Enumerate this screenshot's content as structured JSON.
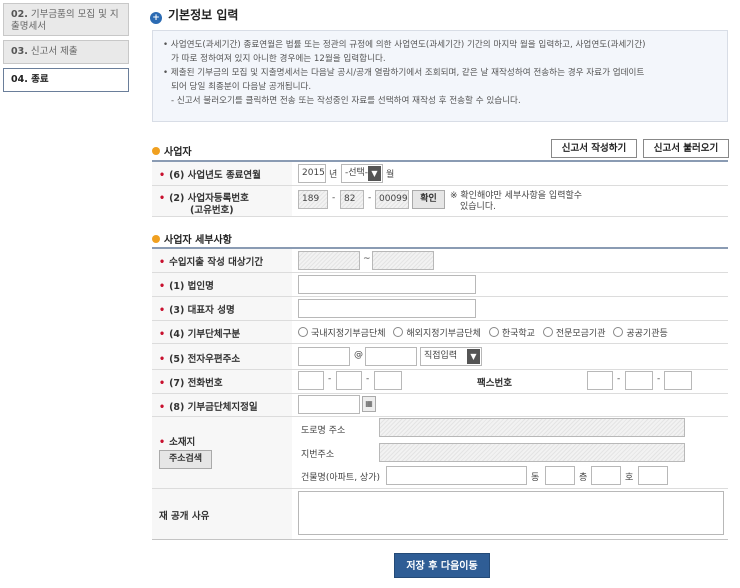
{
  "nav": {
    "items": [
      {
        "num": "02.",
        "label": "기부금품의 모집 및 지출명세서"
      },
      {
        "num": "03.",
        "label": "신고서 제출"
      },
      {
        "num": "04.",
        "label": "종료"
      }
    ]
  },
  "header": {
    "title": "기본정보 입력"
  },
  "info": {
    "lines": [
      "• 사업연도(과세기간) 종료연월은 법률 또는 정관의 규정에 의한 사업연도(과세기간) 기간의 마지막 월을 입력하고, 사업연도(과세기간)",
      "가 따로 정하여져 있지 아니한 경우에는 12월을 입력합니다.",
      "• 제출된 기부금의 모집 및 지출명세서는 다음날 공시/공개 열람하기에서 조회되며, 같은 날 재작성하여 전송하는 경우 자료가 업데이트",
      "되어 당일 최종분이 다음날 공개됩니다.",
      "- 신고서 불러오기를 클릭하면 전송 또는 작성중인 자료를 선택하여 재작성 후 전송할 수 있습니다."
    ]
  },
  "business": {
    "section_title": "사업자",
    "write_button": "신고서 작성하기",
    "load_button": "신고서 불러오기",
    "period_label": "(6) 사업년도 종료연월",
    "year_value": "2015",
    "year_unit": "년",
    "month_select": "-선택-",
    "month_unit": "월",
    "regno_label": "(2) 사업자등록번호",
    "regno_sublabel": "(고유번호)",
    "regno_1": "189",
    "regno_2": "82",
    "regno_3": "00099",
    "dash": "-",
    "confirm_button": "확인",
    "confirm_note_1": "※ 확인해야만 세부사항을 입력할수",
    "confirm_note_2": "있습니다."
  },
  "detail": {
    "section_title": "사업자 세부사항",
    "period_label": "수입지출 작성 대상기간",
    "tilde": "~",
    "corp_label": "(1) 법인명",
    "rep_label": "(3) 대표자 성명",
    "type_label": "(4) 기부단체구분",
    "type_options": [
      "국내지정기부금단체",
      "해외지정기부금단체",
      "한국학교",
      "전문모금기관",
      "공공기관등"
    ],
    "email_label": "(5) 전자우편주소",
    "at": "@",
    "email_domain_select": "직접입력",
    "phone_label": "(7) 전화번호",
    "fax_label": "팩스번호",
    "date_label": "(8) 기부금단체지정일",
    "addr_label": "소재지",
    "addr_search_button": "주소검색",
    "road_addr_label": "도로명 주소",
    "lot_addr_label": "지번주소",
    "building_label": "건물명(아파트, 상가)",
    "dong": "동",
    "floor": "층",
    "ho": "호",
    "reason_label": "재 공개 사유"
  },
  "footer": {
    "save_button": "저장 후 다음이동"
  },
  "colors": {
    "accent": "#2f5d95",
    "required": "#c8102e",
    "section_dot": "#f0a020"
  }
}
